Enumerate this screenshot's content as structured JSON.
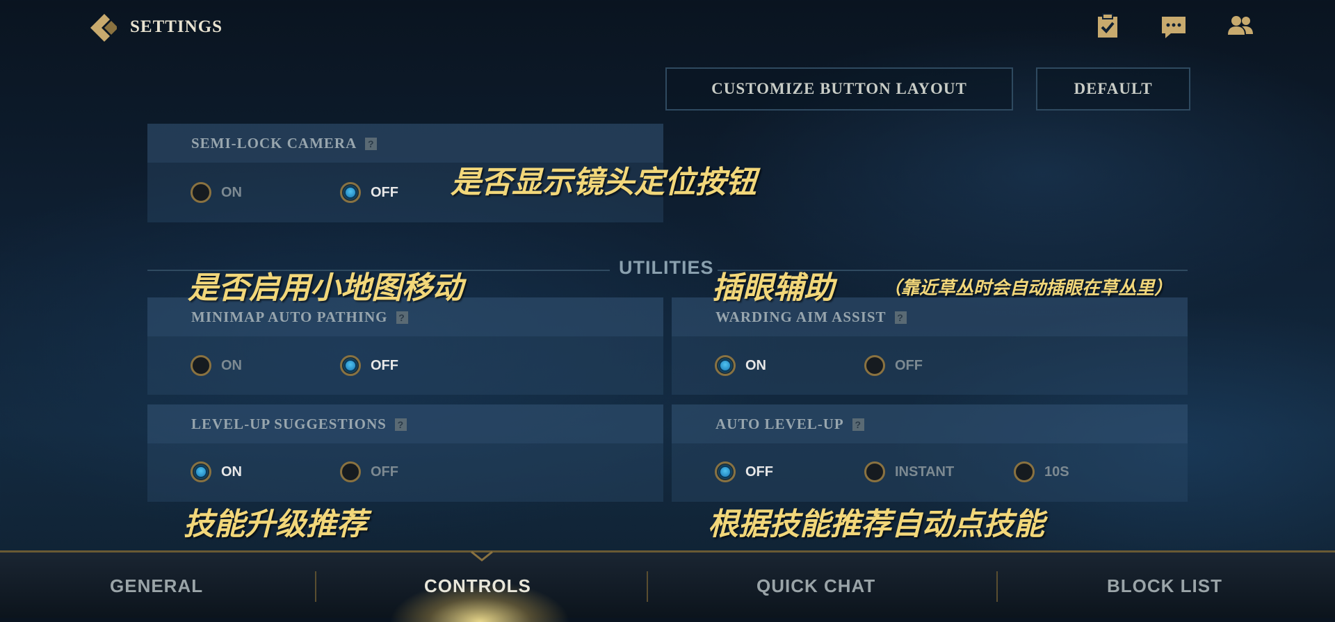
{
  "header": {
    "title": "SETTINGS",
    "icons": [
      "back-icon",
      "clipboard-check-icon",
      "chat-bubble-icon",
      "friends-icon"
    ]
  },
  "top_buttons": {
    "customize": "CUSTOMIZE BUTTON LAYOUT",
    "default": "DEFAULT"
  },
  "section_title": "UTILITIES",
  "settings": {
    "semi_lock_camera": {
      "label": "SEMI-LOCK CAMERA",
      "options": [
        "ON",
        "OFF"
      ],
      "selected": "OFF"
    },
    "minimap_auto_pathing": {
      "label": "MINIMAP AUTO PATHING",
      "options": [
        "ON",
        "OFF"
      ],
      "selected": "OFF"
    },
    "warding_aim_assist": {
      "label": "WARDING AIM ASSIST",
      "options": [
        "ON",
        "OFF"
      ],
      "selected": "ON"
    },
    "level_up_suggestions": {
      "label": "LEVEL-UP SUGGESTIONS",
      "options": [
        "ON",
        "OFF"
      ],
      "selected": "ON"
    },
    "auto_level_up": {
      "label": "AUTO LEVEL-UP",
      "options": [
        "OFF",
        "INSTANT",
        "10S"
      ],
      "selected": "OFF"
    }
  },
  "help_glyph": "?",
  "annotations": {
    "camera": "是否显示镜头定位按钮",
    "minimap": "是否启用小地图移动",
    "warding": "插眼辅助",
    "warding_note": "（靠近草丛时会自动插眼在草丛里）",
    "levelup": "技能升级推荐",
    "autolevel": "根据技能推荐自动点技能"
  },
  "tabs": [
    "GENERAL",
    "CONTROLS",
    "QUICK CHAT",
    "BLOCK LIST"
  ],
  "active_tab": "CONTROLS",
  "colors": {
    "accent_gold": "#c8aa6e",
    "annotation_yellow": "#f2d77a",
    "radio_selected": "#2aa0e0"
  }
}
